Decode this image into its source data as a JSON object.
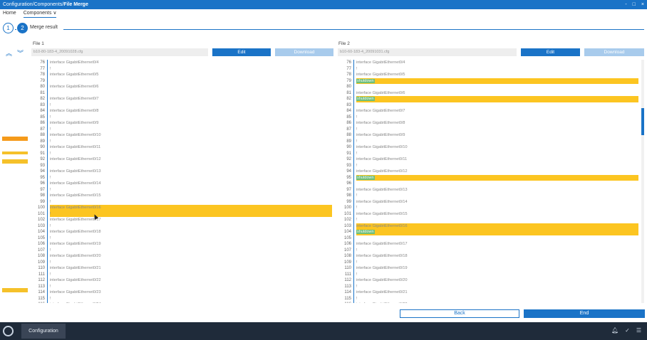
{
  "window": {
    "breadcrumb_prefix": "Configuration/Components/",
    "title": "File Merge",
    "controls": [
      "-",
      "□",
      "×"
    ]
  },
  "menu": {
    "home": "Home",
    "components": "Components ∨"
  },
  "stepper": {
    "step1": "1",
    "step2": "2",
    "label": "Merge result"
  },
  "file1": {
    "label": "File 1",
    "path": "b10-80-183-4_20091028.cfg",
    "edit": "Edit",
    "download": "Download",
    "lines": [
      {
        "n": "76",
        "t": "interface GigabitEthernet0/4",
        "h": ""
      },
      {
        "n": "77",
        "t": "!",
        "h": ""
      },
      {
        "n": "78",
        "t": "interface GigabitEthernet0/5",
        "h": ""
      },
      {
        "n": "79",
        "t": "",
        "h": "y"
      },
      {
        "n": "80",
        "t": "interface GigabitEthernet0/6",
        "h": ""
      },
      {
        "n": "81",
        "t": "",
        "h": "y"
      },
      {
        "n": "82",
        "t": "interface GigabitEthernet0/7",
        "h": ""
      },
      {
        "n": "83",
        "t": "!",
        "h": ""
      },
      {
        "n": "84",
        "t": "interface GigabitEthernet0/8",
        "h": ""
      },
      {
        "n": "85",
        "t": "!",
        "h": ""
      },
      {
        "n": "86",
        "t": "interface GigabitEthernet0/9",
        "h": ""
      },
      {
        "n": "87",
        "t": "!",
        "h": ""
      },
      {
        "n": "88",
        "t": "interface GigabitEthernet0/10",
        "h": ""
      },
      {
        "n": "89",
        "t": "!",
        "h": ""
      },
      {
        "n": "90",
        "t": "interface GigabitEthernet0/11",
        "h": ""
      },
      {
        "n": "91",
        "t": "!",
        "h": ""
      },
      {
        "n": "92",
        "t": "interface GigabitEthernet0/12",
        "h": ""
      },
      {
        "n": "93",
        "t": "",
        "h": "y"
      },
      {
        "n": "94",
        "t": "interface GigabitEthernet0/13",
        "h": ""
      },
      {
        "n": "95",
        "t": "!",
        "h": ""
      },
      {
        "n": "96",
        "t": "interface GigabitEthernet0/14",
        "h": ""
      },
      {
        "n": "97",
        "t": "!",
        "h": ""
      },
      {
        "n": "98",
        "t": "interface GigabitEthernet0/15",
        "h": ""
      },
      {
        "n": "99",
        "t": "!",
        "h": ""
      },
      {
        "n": "100",
        "t": "interface GigabitEthernet0/16",
        "h": "y"
      },
      {
        "n": "101",
        "t": "!",
        "h": "y"
      },
      {
        "n": "102",
        "t": "interface GigabitEthernet0/17",
        "h": ""
      },
      {
        "n": "103",
        "t": "!",
        "h": ""
      },
      {
        "n": "104",
        "t": "interface GigabitEthernet0/18",
        "h": ""
      },
      {
        "n": "105",
        "t": "!",
        "h": ""
      },
      {
        "n": "106",
        "t": "interface GigabitEthernet0/19",
        "h": ""
      },
      {
        "n": "107",
        "t": "!",
        "h": ""
      },
      {
        "n": "108",
        "t": "interface GigabitEthernet0/20",
        "h": ""
      },
      {
        "n": "109",
        "t": "!",
        "h": ""
      },
      {
        "n": "110",
        "t": "interface GigabitEthernet0/21",
        "h": ""
      },
      {
        "n": "111",
        "t": "!",
        "h": ""
      },
      {
        "n": "112",
        "t": "interface GigabitEthernet0/22",
        "h": ""
      },
      {
        "n": "113",
        "t": "!",
        "h": ""
      },
      {
        "n": "114",
        "t": "interface GigabitEthernet0/23",
        "h": ""
      },
      {
        "n": "115",
        "t": "!",
        "h": ""
      },
      {
        "n": "116",
        "t": "interface GigabitEthernet0/24",
        "h": ""
      }
    ]
  },
  "file2": {
    "label": "File 2",
    "path": "b10-60-183-4_20091031.cfg",
    "edit": "Edit",
    "download": "Download",
    "lines": [
      {
        "n": "76",
        "t": "interface GigabitEthernet0/4",
        "h": ""
      },
      {
        "n": "77",
        "t": "!",
        "h": ""
      },
      {
        "n": "78",
        "t": "interface GigabitEthernet0/5",
        "h": ""
      },
      {
        "n": "79",
        "t": "shutdown",
        "h": "y",
        "s": true
      },
      {
        "n": "80",
        "t": "",
        "h": "o"
      },
      {
        "n": "81",
        "t": "interface GigabitEthernet0/6",
        "h": ""
      },
      {
        "n": "82",
        "t": "shutdown",
        "h": "y",
        "s": true
      },
      {
        "n": "83",
        "t": "",
        "h": "y"
      },
      {
        "n": "84",
        "t": "interface GigabitEthernet0/7",
        "h": ""
      },
      {
        "n": "85",
        "t": "!",
        "h": ""
      },
      {
        "n": "86",
        "t": "interface GigabitEthernet0/8",
        "h": ""
      },
      {
        "n": "87",
        "t": "!",
        "h": ""
      },
      {
        "n": "88",
        "t": "interface GigabitEthernet0/9",
        "h": ""
      },
      {
        "n": "89",
        "t": "!",
        "h": ""
      },
      {
        "n": "90",
        "t": "interface GigabitEthernet0/10",
        "h": ""
      },
      {
        "n": "91",
        "t": "!",
        "h": ""
      },
      {
        "n": "92",
        "t": "interface GigabitEthernet0/11",
        "h": ""
      },
      {
        "n": "93",
        "t": "!",
        "h": ""
      },
      {
        "n": "94",
        "t": "interface GigabitEthernet0/12",
        "h": ""
      },
      {
        "n": "95",
        "t": "shutdown",
        "h": "y",
        "s": true
      },
      {
        "n": "96",
        "t": "",
        "h": "y"
      },
      {
        "n": "97",
        "t": "interface GigabitEthernet0/13",
        "h": ""
      },
      {
        "n": "98",
        "t": "!",
        "h": ""
      },
      {
        "n": "99",
        "t": "interface GigabitEthernet0/14",
        "h": ""
      },
      {
        "n": "100",
        "t": "!",
        "h": ""
      },
      {
        "n": "101",
        "t": "interface GigabitEthernet0/15",
        "h": ""
      },
      {
        "n": "102",
        "t": "!",
        "h": ""
      },
      {
        "n": "103",
        "t": "interface GigabitEthernet0/16",
        "h": "y"
      },
      {
        "n": "104",
        "t": "shutdown",
        "h": "y",
        "s": true
      },
      {
        "n": "105",
        "t": "",
        "h": "y"
      },
      {
        "n": "106",
        "t": "interface GigabitEthernet0/17",
        "h": ""
      },
      {
        "n": "107",
        "t": "!",
        "h": ""
      },
      {
        "n": "108",
        "t": "interface GigabitEthernet0/18",
        "h": ""
      },
      {
        "n": "109",
        "t": "!",
        "h": ""
      },
      {
        "n": "110",
        "t": "interface GigabitEthernet0/19",
        "h": ""
      },
      {
        "n": "111",
        "t": "!",
        "h": ""
      },
      {
        "n": "112",
        "t": "interface GigabitEthernet0/20",
        "h": ""
      },
      {
        "n": "113",
        "t": "!",
        "h": ""
      },
      {
        "n": "114",
        "t": "interface GigabitEthernet0/21",
        "h": ""
      },
      {
        "n": "115",
        "t": "!",
        "h": ""
      },
      {
        "n": "116",
        "t": "interface GigabitEthernet0/22",
        "h": ""
      }
    ]
  },
  "footer": {
    "back": "Back",
    "end": "End"
  },
  "taskbar": {
    "task": "Configuration"
  },
  "colors": {
    "accent": "#1a73c7",
    "diff": "#fcc521",
    "diff_strong": "#f59a1a",
    "shutdown_tag": "#6ec07a"
  }
}
